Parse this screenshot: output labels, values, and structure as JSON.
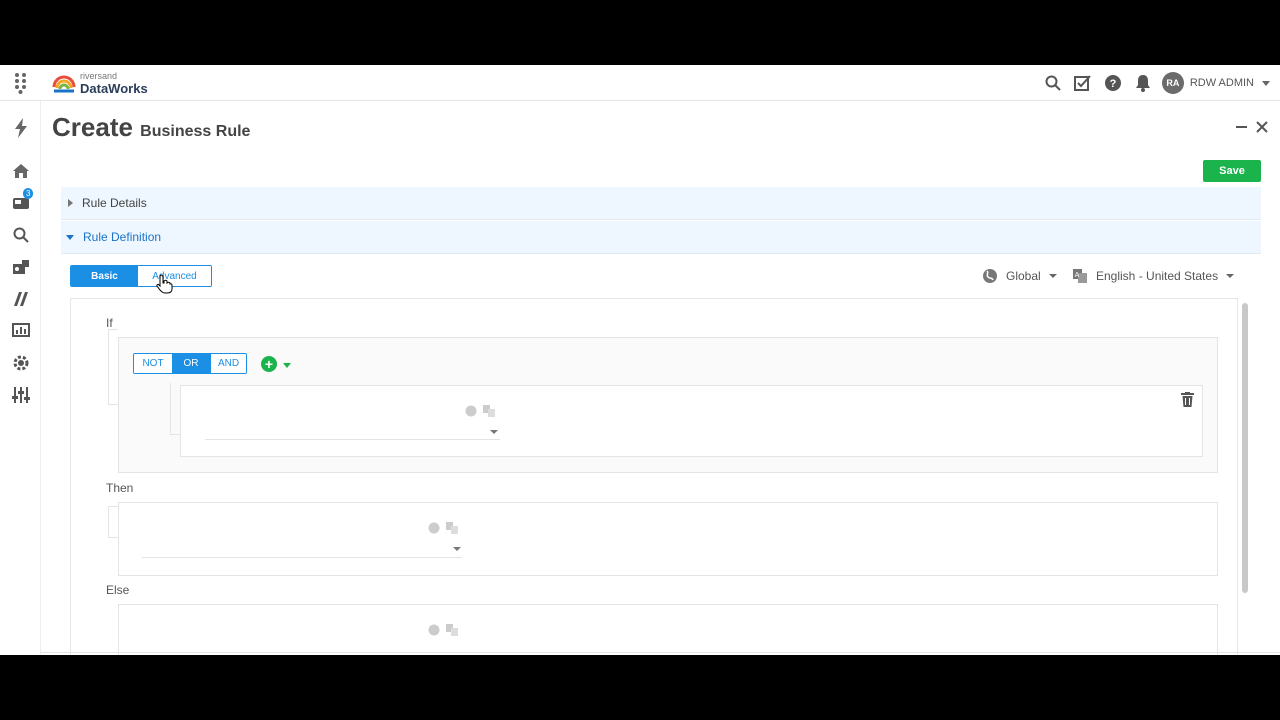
{
  "header": {
    "brand_small": "riversand",
    "brand_name": "DataWorks",
    "user_initials": "RA",
    "user_name": "RDW ADMIN",
    "icons": [
      "search-icon",
      "tasks-icon",
      "help-icon",
      "bell-icon"
    ]
  },
  "sidebar": {
    "items": [
      "lightning-icon",
      "home-icon",
      "entities-icon",
      "search-icon",
      "import-icon",
      "model-icon",
      "dashboard-icon",
      "settings-icon",
      "tools-icon"
    ],
    "badge": "3"
  },
  "page": {
    "title": "Create",
    "subtitle": "Business Rule",
    "save_label": "Save"
  },
  "sections": {
    "details": "Rule Details",
    "definition": "Rule Definition"
  },
  "mode_toggle": {
    "basic": "Basic",
    "advanced": "Advanced"
  },
  "context": {
    "scope": "Global",
    "locale": "English - United States"
  },
  "rule": {
    "if_label": "If",
    "then_label": "Then",
    "else_label": "Else",
    "operators": {
      "not": "NOT",
      "or": "OR",
      "and": "AND"
    },
    "add_symbol": "+"
  },
  "colors": {
    "accent": "#1a8fe3",
    "save": "#1bb34b",
    "section_bg": "#eef6ff"
  }
}
